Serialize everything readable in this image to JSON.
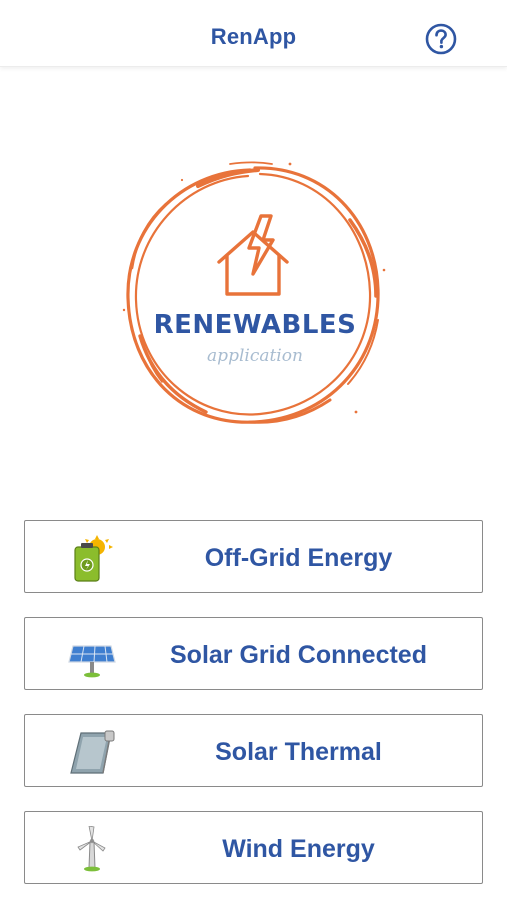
{
  "header": {
    "title": "RenApp",
    "help_icon": "question-circle-icon"
  },
  "logo": {
    "title": "RENEWABLES",
    "subtitle": "application",
    "icon": "house-lightning-icon"
  },
  "menu": {
    "items": [
      {
        "label": "Off-Grid Energy",
        "icon": "battery-sun-icon"
      },
      {
        "label": "Solar Grid Connected",
        "icon": "solar-panel-icon"
      },
      {
        "label": "Solar Thermal",
        "icon": "solar-thermal-collector-icon"
      },
      {
        "label": "Wind Energy",
        "icon": "wind-turbine-icon"
      }
    ]
  },
  "colors": {
    "accent_blue": "#2f56a3",
    "logo_orange": "#e8733a",
    "subtitle_gray_blue": "#a8bcd0",
    "button_border": "#8a8a8a"
  }
}
